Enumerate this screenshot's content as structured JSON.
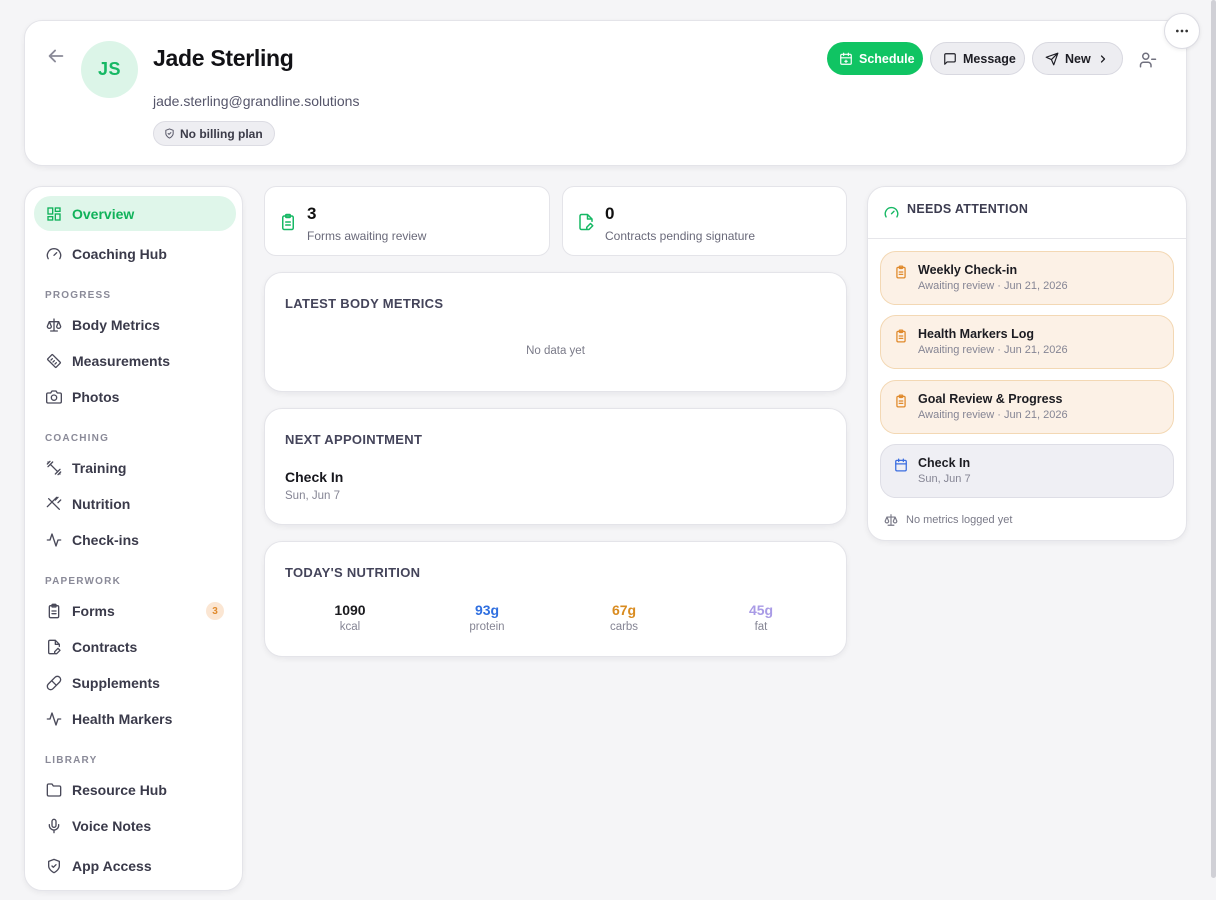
{
  "header": {
    "initials": "JS",
    "name": "Jade Sterling",
    "email": "jade.sterling@grandline.solutions",
    "billing": "No billing plan",
    "schedule_label": "Schedule",
    "message_label": "Message",
    "new_label": "New"
  },
  "sidebar": {
    "items": [
      {
        "label": "Overview",
        "icon": "overview-icon"
      },
      {
        "label": "Coaching Hub",
        "icon": "gauge-icon"
      }
    ],
    "sections": [
      {
        "title": "PROGRESS",
        "items": [
          {
            "label": "Body Metrics",
            "icon": "scale-icon"
          },
          {
            "label": "Measurements",
            "icon": "ruler-icon"
          },
          {
            "label": "Photos",
            "icon": "camera-icon"
          }
        ]
      },
      {
        "title": "COACHING",
        "items": [
          {
            "label": "Training",
            "icon": "dumbbell-icon"
          },
          {
            "label": "Nutrition",
            "icon": "utensils-icon"
          },
          {
            "label": "Check-ins",
            "icon": "activity-icon"
          }
        ]
      },
      {
        "title": "PAPERWORK",
        "items": [
          {
            "label": "Forms",
            "icon": "clipboard-icon",
            "badge": "3"
          },
          {
            "label": "Contracts",
            "icon": "contract-icon"
          },
          {
            "label": "Supplements",
            "icon": "pill-icon"
          },
          {
            "label": "Health Markers",
            "icon": "activity-icon"
          }
        ]
      },
      {
        "title": "LIBRARY",
        "items": [
          {
            "label": "Resource Hub",
            "icon": "folder-icon"
          },
          {
            "label": "Voice Notes",
            "icon": "mic-icon"
          },
          {
            "label": "App Access",
            "icon": "shield-icon"
          }
        ]
      }
    ]
  },
  "stats": [
    {
      "value": "3",
      "label": "Forms awaiting review"
    },
    {
      "value": "0",
      "label": "Contracts pending signature"
    }
  ],
  "body_metrics": {
    "title": "LATEST BODY METRICS",
    "empty": "No data yet"
  },
  "appointment": {
    "title": "NEXT APPOINTMENT",
    "name": "Check In",
    "date": "Sun, Jun 7"
  },
  "nutrition": {
    "title": "TODAY'S NUTRITION",
    "macros": [
      {
        "value": "1090",
        "unit": "kcal",
        "color": "#1b1b1f"
      },
      {
        "value": "93g",
        "unit": "protein",
        "color": "#2f6fe0"
      },
      {
        "value": "67g",
        "unit": "carbs",
        "color": "#d98b1f"
      },
      {
        "value": "45g",
        "unit": "fat",
        "color": "#a99be6"
      }
    ]
  },
  "attention": {
    "title": "NEEDS ATTENTION",
    "items": [
      {
        "title": "Weekly Check-in",
        "sub": "Awaiting review · Jun 21, 2026",
        "type": "form"
      },
      {
        "title": "Health Markers Log",
        "sub": "Awaiting review · Jun 21, 2026",
        "type": "form"
      },
      {
        "title": "Goal Review & Progress",
        "sub": "Awaiting review · Jun 21, 2026",
        "type": "form"
      },
      {
        "title": "Check In",
        "sub": "Sun, Jun 7",
        "type": "event"
      }
    ],
    "footer": "No metrics logged yet"
  },
  "colors": {
    "accent": "#10c463",
    "warning": "#e08a2c",
    "info": "#3b6ee0"
  }
}
